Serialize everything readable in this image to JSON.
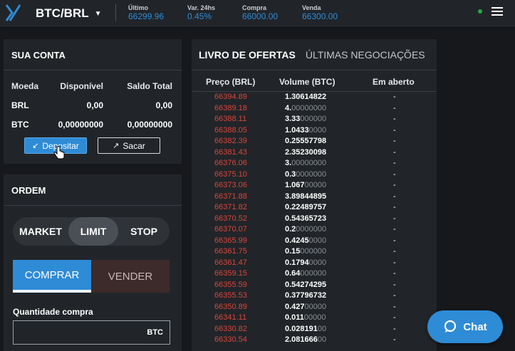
{
  "topbar": {
    "pair": "BTC/BRL",
    "stats": [
      {
        "label": "Último",
        "value": "66299.96"
      },
      {
        "label": "Var. 24hs",
        "value": "0.45%"
      },
      {
        "label": "Compra",
        "value": "66000.00"
      },
      {
        "label": "Venda",
        "value": "66300.00"
      }
    ],
    "status_color": "#29a745"
  },
  "account": {
    "title": "SUA CONTA",
    "headers": [
      "Moeda",
      "Disponível",
      "Saldo Total"
    ],
    "rows": [
      {
        "coin": "BRL",
        "available": "0,00",
        "total": "0,00"
      },
      {
        "coin": "BTC",
        "available": "0,00000000",
        "total": "0,00000000"
      }
    ],
    "deposit_label": "Depositar",
    "withdraw_label": "Sacar"
  },
  "order": {
    "title": "ORDEM",
    "types": [
      "MARKET",
      "LIMIT",
      "STOP"
    ],
    "selected_type": "LIMIT",
    "buy_label": "COMPRAR",
    "sell_label": "VENDER",
    "quantity_label": "Quantidade compra",
    "quantity_currency": "BTC"
  },
  "book": {
    "tab_active": "LIVRO DE OFERTAS",
    "tab_other": "ÚLTIMAS NEGOCIAÇÕES",
    "columns": [
      "Preço (BRL)",
      "Volume (BTC)",
      "Em aberto"
    ],
    "rows": [
      {
        "price": "66394.89",
        "vol_main": "1.30614822",
        "vol_dim": "",
        "open": "-"
      },
      {
        "price": "66389.18",
        "vol_main": "4.",
        "vol_dim": "00000000",
        "open": "-"
      },
      {
        "price": "66388.11",
        "vol_main": "3.33",
        "vol_dim": "000000",
        "open": "-"
      },
      {
        "price": "66388.05",
        "vol_main": "1.0433",
        "vol_dim": "0000",
        "open": "-"
      },
      {
        "price": "66382.39",
        "vol_main": "0.25557798",
        "vol_dim": "",
        "open": "-"
      },
      {
        "price": "66381.43",
        "vol_main": "2.35230098",
        "vol_dim": "",
        "open": "-"
      },
      {
        "price": "66376.06",
        "vol_main": "3.",
        "vol_dim": "00000000",
        "open": "-"
      },
      {
        "price": "66375.10",
        "vol_main": "0.3",
        "vol_dim": "0000000",
        "open": "-"
      },
      {
        "price": "66373.06",
        "vol_main": "1.067",
        "vol_dim": "00000",
        "open": "-"
      },
      {
        "price": "66371.88",
        "vol_main": "3.89844895",
        "vol_dim": "",
        "open": "-"
      },
      {
        "price": "66371.82",
        "vol_main": "0.22489757",
        "vol_dim": "",
        "open": "-"
      },
      {
        "price": "66370.52",
        "vol_main": "0.54365723",
        "vol_dim": "",
        "open": "-"
      },
      {
        "price": "66370.07",
        "vol_main": "0.2",
        "vol_dim": "0000000",
        "open": "-"
      },
      {
        "price": "66365.99",
        "vol_main": "0.4245",
        "vol_dim": "0000",
        "open": "-"
      },
      {
        "price": "66361.75",
        "vol_main": "0.15",
        "vol_dim": "000000",
        "open": "-"
      },
      {
        "price": "66361.47",
        "vol_main": "0.1794",
        "vol_dim": "0000",
        "open": "-"
      },
      {
        "price": "66359.15",
        "vol_main": "0.64",
        "vol_dim": "000000",
        "open": "-"
      },
      {
        "price": "66355.59",
        "vol_main": "0.54274295",
        "vol_dim": "",
        "open": "-"
      },
      {
        "price": "66355.53",
        "vol_main": "0.37796732",
        "vol_dim": "",
        "open": "-"
      },
      {
        "price": "66350.89",
        "vol_main": "0.427",
        "vol_dim": "00000",
        "open": "-"
      },
      {
        "price": "66341.11",
        "vol_main": "0.011",
        "vol_dim": "00000",
        "open": "-"
      },
      {
        "price": "66330.82",
        "vol_main": "0.028191",
        "vol_dim": "00",
        "open": "-"
      },
      {
        "price": "66330.54",
        "vol_main": "2.081666",
        "vol_dim": "00",
        "open": "-"
      }
    ]
  },
  "chat": {
    "label": "Chat"
  }
}
